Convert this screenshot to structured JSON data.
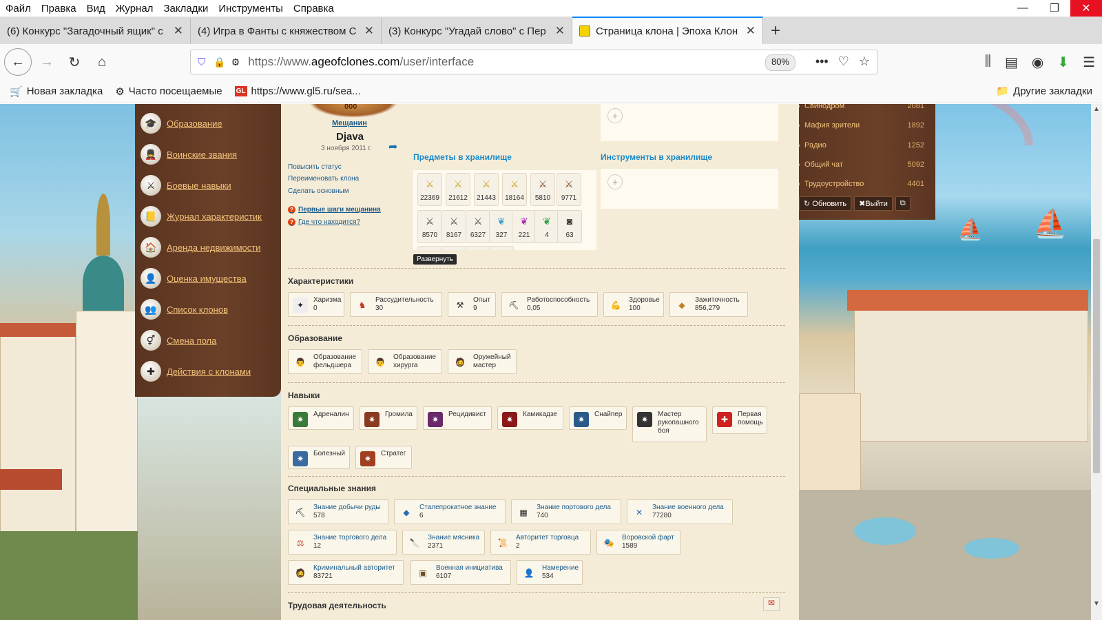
{
  "menu": {
    "file": "Файл",
    "edit": "Правка",
    "view": "Вид",
    "history": "Журнал",
    "bookmarks": "Закладки",
    "tools": "Инструменты",
    "help": "Справка"
  },
  "tabs": [
    {
      "title": "(6) Конкурс \"Загадочный ящик\" с"
    },
    {
      "title": "(4) Игра в Фанты с княжеством С"
    },
    {
      "title": "(3) Конкурс \"Угадай слово\" с Пер"
    },
    {
      "title": "Страница клона | Эпоха Клон"
    }
  ],
  "url": {
    "prefix": "https://www.",
    "domain": "ageofclones.com",
    "path": "/user/interface",
    "zoom": "80%"
  },
  "bookmarks": {
    "new": "Новая закладка",
    "frequent": "Часто посещаемые",
    "gl": "https://www.gl5.ru/sea...",
    "other": "Другие закладки"
  },
  "left_menu": [
    {
      "label": "Образование",
      "icon": "graduation-cap-icon"
    },
    {
      "label": "Воинские звания",
      "icon": "soldier-icon"
    },
    {
      "label": "Боевые навыки",
      "icon": "crossed-swords-icon"
    },
    {
      "label": "Журнал характеристик",
      "icon": "journal-icon"
    },
    {
      "label": "Аренда недвижимости",
      "icon": "rent-icon"
    },
    {
      "label": "Оценка имущества",
      "icon": "appraisal-icon"
    },
    {
      "label": "Список клонов",
      "icon": "clones-icon"
    },
    {
      "label": "Смена пола",
      "icon": "gender-icon"
    },
    {
      "label": "Действия с клонами",
      "icon": "clone-action-icon"
    }
  ],
  "profile": {
    "crest": "000",
    "rank": "Мещанин",
    "name": "Djava",
    "date": "3 ноября 2011 г.",
    "links": [
      "Повысить статус",
      "Переименовать клона",
      "Сделать основным"
    ],
    "help": [
      "Первые шаги мещанина",
      "Где что находится?"
    ]
  },
  "storage": {
    "title": "Предметы в хранилище",
    "expand": "Развернуть",
    "items": [
      "22369",
      "21612",
      "21443",
      "18164",
      "5810",
      "9771",
      "8570",
      "8167",
      "6327",
      "327",
      "221",
      "4",
      "63"
    ]
  },
  "tools": {
    "title": "Инструменты в хранилище"
  },
  "characteristics": {
    "title": "Характеристики",
    "items": [
      {
        "name": "Харизма",
        "value": "0"
      },
      {
        "name": "Рассудительность",
        "value": "30"
      },
      {
        "name": "Опыт",
        "value": "9"
      },
      {
        "name": "Работоспособность",
        "value": "0,05"
      },
      {
        "name": "Здоровье",
        "value": "100"
      },
      {
        "name": "Зажиточность",
        "value": "856,279"
      }
    ]
  },
  "education": {
    "title": "Образование",
    "items": [
      {
        "l1": "Образование",
        "l2": "фельдшера"
      },
      {
        "l1": "Образование",
        "l2": "хирурга"
      },
      {
        "l1": "Оружейный",
        "l2": "мастер"
      }
    ]
  },
  "skills": {
    "title": "Навыки",
    "items": [
      "Адреналин",
      "Громила",
      "Рецидивист",
      "Камикадзе",
      "Снайпер"
    ],
    "master": {
      "l1": "Мастер",
      "l2": "рукопашного",
      "l3": "боя"
    },
    "firstaid": {
      "l1": "Первая",
      "l2": "помощь"
    },
    "row2": [
      "Болезный",
      "Стратег"
    ]
  },
  "special": {
    "title": "Специальные знания",
    "items": [
      {
        "name": "Знание добычи руды",
        "value": "578"
      },
      {
        "name": "Сталепрокатное знание",
        "value": "6"
      },
      {
        "name": "Знание портового дела",
        "value": "740"
      },
      {
        "name": "Знание военного дела",
        "value": "77280"
      },
      {
        "name": "Знание торгового дела",
        "value": "12"
      },
      {
        "name": "Знание мясника",
        "value": "2371"
      },
      {
        "name": "Авторитет торговца",
        "value": "2"
      },
      {
        "name": "Воровской фарт",
        "value": "1589"
      },
      {
        "name": "Криминальный авторитет",
        "value": "83721"
      },
      {
        "name": "Военная инициатива",
        "value": "6107"
      },
      {
        "name": "Намерение",
        "value": "534"
      }
    ]
  },
  "next_section": "Трудовая деятельность",
  "chat": {
    "rooms": [
      {
        "name": "Свинодром",
        "count": "2081"
      },
      {
        "name": "Мафия зрители",
        "count": "1892"
      },
      {
        "name": "Радио",
        "count": "1252"
      },
      {
        "name": "Общий чат",
        "count": "5092"
      },
      {
        "name": "Трудоустройство",
        "count": "4401"
      }
    ],
    "refresh": "Обновить",
    "exit": "Выйти"
  },
  "colors": {
    "accent": "#1a8acb",
    "menu_bg": "#5a3420",
    "menu_text": "#f1c27a",
    "content_bg": "#f5ecd8"
  }
}
